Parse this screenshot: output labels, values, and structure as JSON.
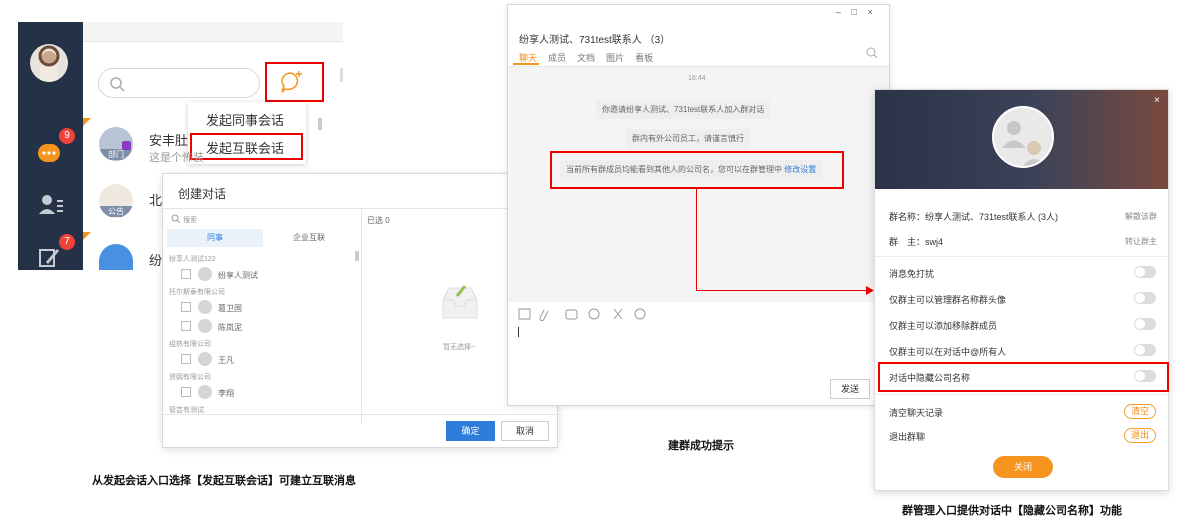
{
  "panel1": {
    "unread_badge_1": "9",
    "unread_badge_2": "7",
    "menu": {
      "item1": "发起同事会话",
      "item2": "发起互联会话"
    },
    "list": [
      {
        "name": "安丰肚",
        "preview": "这是个怖装",
        "avatar_tag": "部门"
      },
      {
        "name": "北",
        "avatar_tag": "公告"
      },
      {
        "name": "纷"
      }
    ],
    "dialog": {
      "title": "创建对话",
      "search_placeholder": "搜索",
      "selected_label": "已选 0",
      "tab_colleague": "同事",
      "tab_enterprise": "企业互联",
      "groups": [
        {
          "header": "纷享人测试122",
          "members": [
            "纷享人测试"
          ]
        },
        {
          "header": "托尔斯泰有限公司",
          "members": [
            "葛卫国",
            "陈岚泥"
          ]
        },
        {
          "header": "组热有限公司",
          "members": [
            "王凡"
          ]
        },
        {
          "header": "资弼有限公司",
          "members": [
            "李翔"
          ]
        },
        {
          "header": "管芸有测试",
          "members": []
        }
      ],
      "empty_text": "暂无选择~",
      "confirm": "确定",
      "cancel": "取消"
    }
  },
  "panel2": {
    "title": "纷享人测试、731test联系人 （3）",
    "tabs": [
      "聊天",
      "成员",
      "文档",
      "图片",
      "看板"
    ],
    "time": "16:44",
    "messages": [
      "你邀请纷享人测试、731test联系人加入群对话",
      "群内有外公司员工，请谨言慎行"
    ],
    "notice": "当前所有群成员均能看到其他人的公司名，您可以在群管理中",
    "notice_link": "修改设置",
    "send": "发送",
    "win_controls": [
      "–",
      "□",
      "×"
    ]
  },
  "panel3": {
    "group_name_label": "群名称：纷享人测试、731test联系人 (3人)",
    "dismiss": "解散该群",
    "owner_label": "群　主：swj4",
    "transfer": "转让群主",
    "toggles": [
      "消息免打扰",
      "仅群主可以管理群名称群头像",
      "仅群主可以添加移除群成员",
      "仅群主可以在对话中@所有人",
      "对话中隐藏公司名称"
    ],
    "clear_history_label": "清空聊天记录",
    "clear_btn": "清空",
    "exit_label": "退出群聊",
    "exit_btn": "退出",
    "close_btn": "关闭"
  },
  "captions": {
    "left": "从发起会话入口选择【发起互联会话】可建立互联消息",
    "middle": "建群成功提示",
    "right": "群管理入口提供对话中【隐藏公司名称】功能"
  },
  "colors": {
    "accent_red": "#e00000",
    "orange": "#f5941f",
    "sidebar": "#243146",
    "link_blue": "#2e7ddb"
  }
}
